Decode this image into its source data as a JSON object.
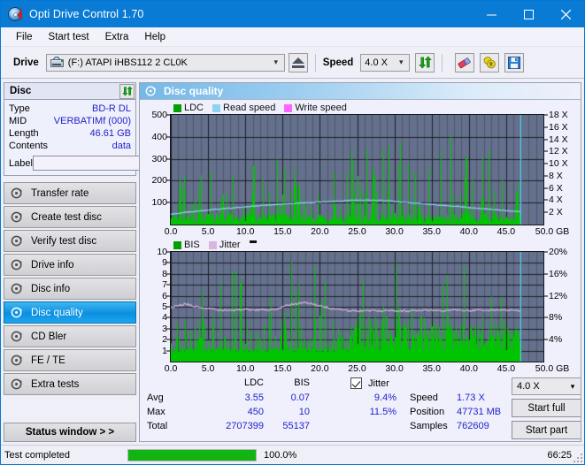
{
  "window": {
    "title": "Opti Drive Control 1.70",
    "icon": "disc-icon",
    "minimize": "minimize-icon",
    "maximize": "maximize-icon",
    "close": "close-icon"
  },
  "menu": {
    "items": [
      {
        "label": "File"
      },
      {
        "label": "Start test"
      },
      {
        "label": "Extra"
      },
      {
        "label": "Help"
      }
    ]
  },
  "toolbar": {
    "drive_label": "Drive",
    "drive_value": "(F:)  ATAPI iHBS112  2 CL0K",
    "eject_title": "eject-icon",
    "speed_label": "Speed",
    "speed_value": "4.0 X",
    "refresh_title": "refresh-icon",
    "eraser_title": "eraser-icon",
    "coin_title": "coin-icon",
    "save_title": "save-icon"
  },
  "sidebar": {
    "disc": {
      "title": "Disc",
      "refresh_icon": "refresh-icon",
      "rows": [
        {
          "key": "Type",
          "value": "BD-R DL"
        },
        {
          "key": "MID",
          "value": "VERBATIMf (000)"
        },
        {
          "key": "Length",
          "value": "46.61 GB"
        },
        {
          "key": "Contents",
          "value": "data"
        }
      ],
      "label_key": "Label",
      "label_value": "",
      "label_placeholder": "",
      "label_button_icon": "cd-icon"
    },
    "nav": [
      {
        "label": "Transfer rate",
        "icon": "disc-test-icon",
        "active": false
      },
      {
        "label": "Create test disc",
        "icon": "disc-test-icon",
        "active": false
      },
      {
        "label": "Verify test disc",
        "icon": "disc-test-icon",
        "active": false
      },
      {
        "label": "Drive info",
        "icon": "disc-test-icon",
        "active": false
      },
      {
        "label": "Disc info",
        "icon": "disc-test-icon",
        "active": false
      },
      {
        "label": "Disc quality",
        "icon": "disc-test-icon",
        "active": true
      },
      {
        "label": "CD Bler",
        "icon": "disc-test-icon",
        "active": false
      },
      {
        "label": "FE / TE",
        "icon": "disc-test-icon",
        "active": false
      },
      {
        "label": "Extra tests",
        "icon": "disc-test-icon",
        "active": false
      }
    ],
    "status_window_button": "Status window > >"
  },
  "panel": {
    "title": "Disc quality",
    "icon": "disc-quality-icon"
  },
  "chart_data": [
    {
      "type": "line",
      "name": "top-chart",
      "title": "",
      "legend": [
        {
          "label": "LDC",
          "color": "#00a000"
        },
        {
          "label": "Read speed",
          "color": "#8ed2f2"
        },
        {
          "label": "Write speed",
          "color": "#ff66ff"
        }
      ],
      "legend_position": "top-left",
      "grid": true,
      "xlabel": "GB",
      "x_ticks": [
        "0.0",
        "5.0",
        "10.0",
        "15.0",
        "20.0",
        "25.0",
        "30.0",
        "35.0",
        "40.0",
        "45.0",
        "50.0 GB"
      ],
      "xlim": [
        0,
        50
      ],
      "ylabel_left": "LDC",
      "y_ticks_left": [
        "100",
        "200",
        "300",
        "400",
        "500"
      ],
      "ylim_left": [
        0,
        500
      ],
      "ylabel_right": "Speed",
      "y_ticks_right": [
        "2 X",
        "4 X",
        "6 X",
        "8 X",
        "10 X",
        "12 X",
        "14 X",
        "16 X",
        "18 X"
      ],
      "ylim_right": [
        0,
        18
      ],
      "series": [
        {
          "name": "Read speed",
          "color": "#8ed2f2",
          "x": [
            0.0,
            2.0,
            5.0,
            8.0,
            11.0,
            14.0,
            17.0,
            20.0,
            23.0,
            25.0,
            27.0,
            29.0,
            31.0,
            34.0,
            37.0,
            40.0,
            43.0,
            46.0,
            46.9
          ],
          "y": [
            1.7,
            2.0,
            2.4,
            2.7,
            3.0,
            3.3,
            3.5,
            3.7,
            3.9,
            4.0,
            4.0,
            3.9,
            3.7,
            3.4,
            3.1,
            2.8,
            2.5,
            2.2,
            2.1
          ]
        }
      ],
      "data_end_gb": 46.9,
      "cursor_gb": 46.9
    },
    {
      "type": "line",
      "name": "bottom-chart",
      "title": "",
      "legend": [
        {
          "label": "BIS",
          "color": "#00a000"
        },
        {
          "label": "Jitter",
          "color": "#d8b6de"
        }
      ],
      "legend_position": "top-left",
      "grid": true,
      "xlabel": "GB",
      "x_ticks": [
        "0.0",
        "5.0",
        "10.0",
        "15.0",
        "20.0",
        "25.0",
        "30.0",
        "35.0",
        "40.0",
        "45.0",
        "50.0 GB"
      ],
      "xlim": [
        0,
        50
      ],
      "ylabel_left": "BIS",
      "y_ticks_left": [
        "1",
        "2",
        "3",
        "4",
        "5",
        "6",
        "7",
        "8",
        "9",
        "10"
      ],
      "ylim_left": [
        0,
        10
      ],
      "ylabel_right": "Jitter",
      "y_ticks_right": [
        "4%",
        "8%",
        "12%",
        "16%",
        "20%"
      ],
      "ylim_right": [
        0,
        20
      ],
      "series": [
        {
          "name": "Jitter",
          "color": "#d8b6de",
          "x": [
            0.0,
            2.0,
            4.0,
            6.0,
            8.0,
            10.0,
            12.0,
            14.0,
            16.0,
            18.0,
            20.0,
            22.0,
            24.0,
            26.0,
            28.0,
            30.0,
            32.0,
            34.0,
            36.0,
            38.0,
            40.0,
            42.0,
            44.0,
            46.0,
            46.9
          ],
          "y": [
            9.9,
            10.5,
            9.8,
            9.5,
            9.3,
            9.5,
            9.4,
            9.5,
            10.4,
            10.7,
            10.2,
            9.6,
            9.2,
            9.3,
            9.2,
            9.3,
            9.2,
            9.4,
            9.3,
            9.4,
            9.3,
            9.4,
            9.3,
            9.4,
            9.3
          ]
        }
      ],
      "data_end_gb": 46.9,
      "cursor_gb": 46.9
    }
  ],
  "stats": {
    "col_headers": [
      "LDC",
      "BIS"
    ],
    "rows": [
      {
        "label": "Avg",
        "ldc": "3.55",
        "bis": "0.07",
        "jitter": "9.4%"
      },
      {
        "label": "Max",
        "ldc": "450",
        "bis": "10",
        "jitter": "11.5%"
      },
      {
        "label": "Total",
        "ldc": "2707399",
        "bis": "55137",
        "jitter": ""
      }
    ],
    "jitter_checkbox_label": "Jitter",
    "jitter_checked": true,
    "speed_label": "Speed",
    "speed_value": "1.73 X",
    "position_label": "Position",
    "position_value": "47731 MB",
    "samples_label": "Samples",
    "samples_value": "762609",
    "speed_select_value": "4.0 X",
    "start_full_button": "Start full",
    "start_part_button": "Start part"
  },
  "statusbar": {
    "message": "Test completed",
    "progress_percent": "100.0%",
    "progress_value": 100,
    "elapsed": "66:25"
  }
}
